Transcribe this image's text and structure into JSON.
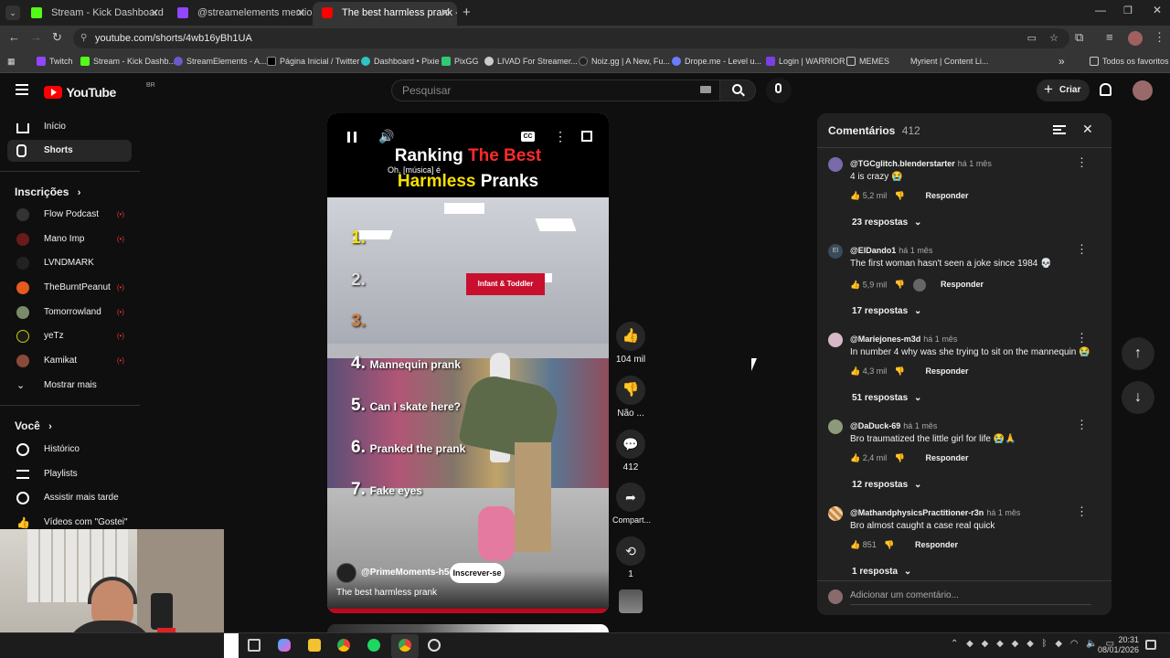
{
  "browser": {
    "tabs": [
      {
        "title": "Stream - Kick Dashboard",
        "color": "#53fc18"
      },
      {
        "title": "@streamelements mentione",
        "color": "#9146ff"
      },
      {
        "title": "The best harmless prank - Y",
        "color": "#ff0000"
      }
    ],
    "url": "youtube.com/shorts/4wb16yBh1UA",
    "bookmarks": [
      "Twitch",
      "Stream - Kick Dashb...",
      "StreamElements - A...",
      "Página Inicial / Twitter",
      "Dashboard • Pixie",
      "PixGG",
      "LIVAD For Streamer...",
      "Noiz.gg | A New, Fu...",
      "Drope.me - Level u...",
      "Login | WARRIOR",
      "MEMES",
      "Myrient | Content Li..."
    ],
    "all_favorites": "Todos os favoritos"
  },
  "youtube": {
    "logo": "YouTube",
    "region": "BR",
    "search_placeholder": "Pesquisar",
    "create_label": "Criar"
  },
  "sidebar": {
    "main": [
      "Início",
      "Shorts"
    ],
    "subscriptions_title": "Inscrições",
    "subscriptions": [
      "Flow Podcast",
      "Mano Imp",
      "LVNDMARK",
      "TheBurntPeanut",
      "Tomorrowland",
      "yeTz",
      "Kamikat"
    ],
    "show_more": "Mostrar mais",
    "you_title": "Você",
    "you_items": [
      "Histórico",
      "Playlists",
      "Assistir mais tarde",
      "Vídeos com \"Gostei\""
    ]
  },
  "video": {
    "title_line1a": "Ranking ",
    "title_line1b": "The Best",
    "subtitle_caption": "Oh, [música] é",
    "title_line2a": "Harmless",
    "title_line2b": " Pranks",
    "ranks": [
      {
        "num": "1.",
        "text": ""
      },
      {
        "num": "2.",
        "text": ""
      },
      {
        "num": "3.",
        "text": ""
      },
      {
        "num": "4.",
        "text": "Mannequin prank"
      },
      {
        "num": "5.",
        "text": "Can I skate here?"
      },
      {
        "num": "6.",
        "text": "Pranked the prank"
      },
      {
        "num": "7.",
        "text": "Fake eyes"
      }
    ],
    "sign_text": "Infant & Toddler",
    "channel": "@PrimeMoments-h5q",
    "subscribe": "Inscrever-se",
    "caption": "The best harmless prank"
  },
  "actions": {
    "likes": "104 mil",
    "dislike": "Não ...",
    "comments": "412",
    "share": "Compart...",
    "remix": "1"
  },
  "comments_panel": {
    "title": "Comentários",
    "count": "412",
    "add_placeholder": "Adicionar um comentário...",
    "reply_label": "Responder",
    "items": [
      {
        "author": "@TGCglitch.blenderstarter",
        "time": "há 1 mês",
        "text": "4 is crazy 😭",
        "likes": "5,2 mil",
        "replies": "23 respostas"
      },
      {
        "author": "@ElDando1",
        "time": "há 1 mês",
        "text": "The first woman hasn't seen a joke since 1984 💀",
        "likes": "5,9 mil",
        "replies": "17 respostas"
      },
      {
        "author": "@Mariejones-m3d",
        "time": "há 1 mês",
        "text": "In number 4 why was she trying to sit on the mannequin 😭",
        "likes": "4,3 mil",
        "replies": "51 respostas"
      },
      {
        "author": "@DaDuck-69",
        "time": "há 1 mês",
        "text": "Bro traumatized the little girl for life 😭🙏",
        "likes": "2,4 mil",
        "replies": "12 respostas"
      },
      {
        "author": "@MathandphysicsPractitioner-r3n",
        "time": "há 1 mês",
        "text": "Bro almost caught a case real quick",
        "likes": "851",
        "replies": "1 resposta"
      }
    ]
  },
  "taskbar": {
    "time": "20:31",
    "date": "08/01/2026"
  }
}
